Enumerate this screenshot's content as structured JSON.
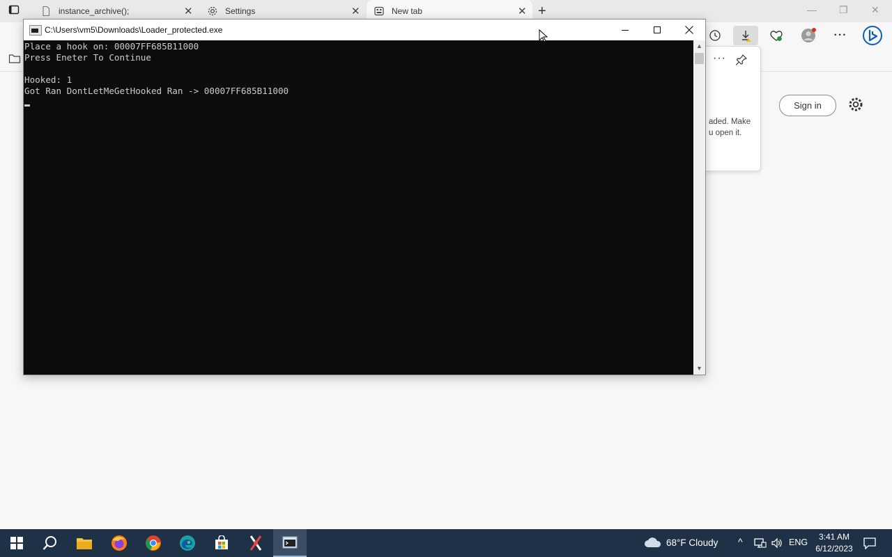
{
  "browser": {
    "tabs": [
      {
        "title": "instance_archive();",
        "icon": "document-icon",
        "close": "✕"
      },
      {
        "title": "Settings",
        "icon": "gear-icon",
        "close": "✕"
      },
      {
        "title": "New tab",
        "icon": "newtab-icon",
        "close": "✕"
      }
    ],
    "new_tab_symbol": "+",
    "window_controls": {
      "minimize": "—",
      "restore": "❐",
      "close": "✕"
    },
    "download_panel": {
      "more": "···",
      "message": "aded. Make\nu open it."
    },
    "sign_in_label": "Sign in",
    "accent": "#0a5fb4"
  },
  "console": {
    "title": "C:\\Users\\vm5\\Downloads\\Loader_protected.exe",
    "lines": [
      "Place a hook on: 00007FF685B11000",
      "Press Eneter To Continue",
      "",
      "Hooked: 1",
      "Got Ran DontLetMeGetHooked Ran -> 00007FF685B11000"
    ],
    "scroll_up": "▲",
    "scroll_down": "▼"
  },
  "taskbar": {
    "apps": [
      "start-icon",
      "search-icon",
      "file-explorer-icon",
      "firefox-icon",
      "chrome-icon",
      "edge-icon",
      "store-icon",
      "tool-icon",
      "console-app-icon"
    ],
    "weather": "68°F  Cloudy",
    "language": "ENG",
    "time": "3:41 AM",
    "date": "6/12/2023"
  }
}
